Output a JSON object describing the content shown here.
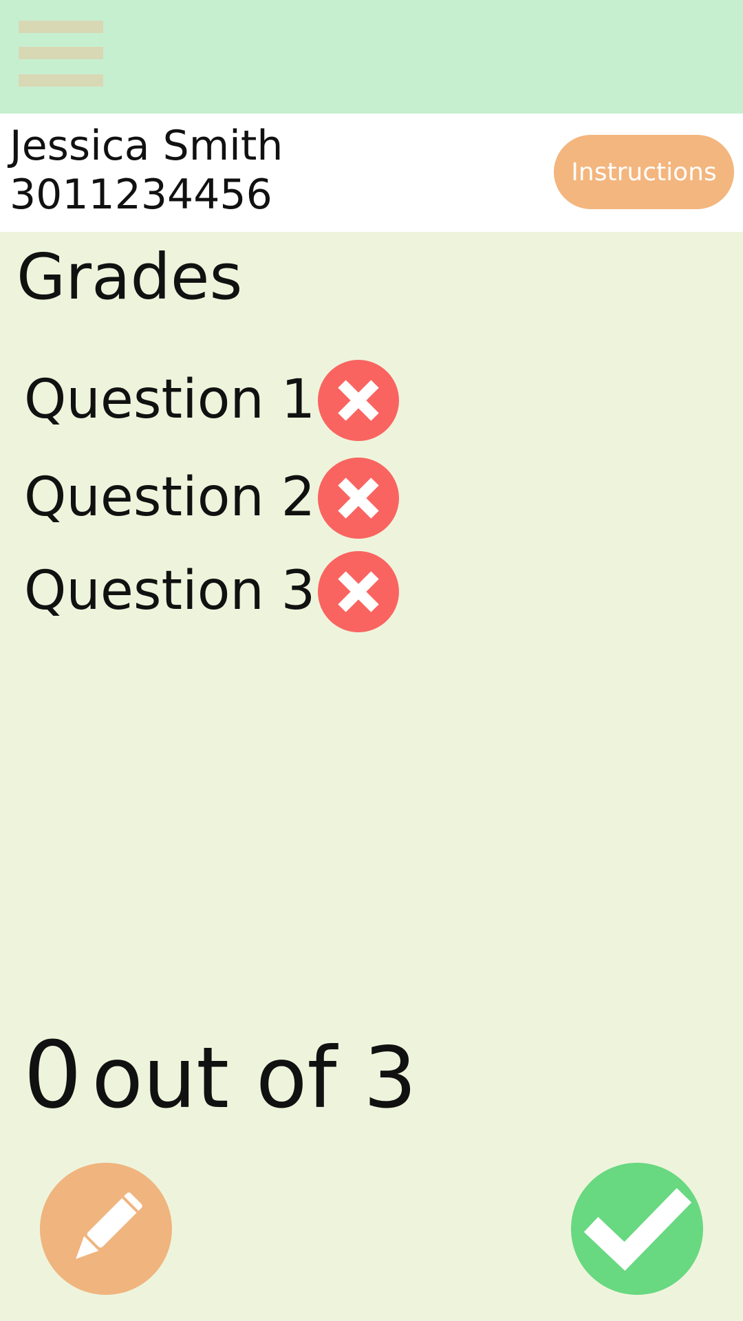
{
  "header": {
    "menu_icon": "hamburger-menu-icon"
  },
  "user": {
    "name": "Jessica Smith",
    "id": "3011234456"
  },
  "instructions_button": {
    "label": "Instructions"
  },
  "grades": {
    "title": "Grades",
    "questions": [
      {
        "label": "Question 1",
        "status": "incorrect",
        "icon": "x-circle-icon"
      },
      {
        "label": "Question 2",
        "status": "incorrect",
        "icon": "x-circle-icon"
      },
      {
        "label": "Question 3",
        "status": "incorrect",
        "icon": "x-circle-icon"
      }
    ]
  },
  "score": {
    "value": "0",
    "text": "out of 3"
  },
  "actions": {
    "edit_icon": "pencil-icon",
    "confirm_icon": "checkmark-icon"
  },
  "colors": {
    "header_bg": "#c6efd0",
    "page_bg": "#eef4dc",
    "instructions_bg": "#f3b67e",
    "incorrect": "#f96461",
    "edit_bg": "#f0b47e",
    "confirm_bg": "#68d881"
  }
}
